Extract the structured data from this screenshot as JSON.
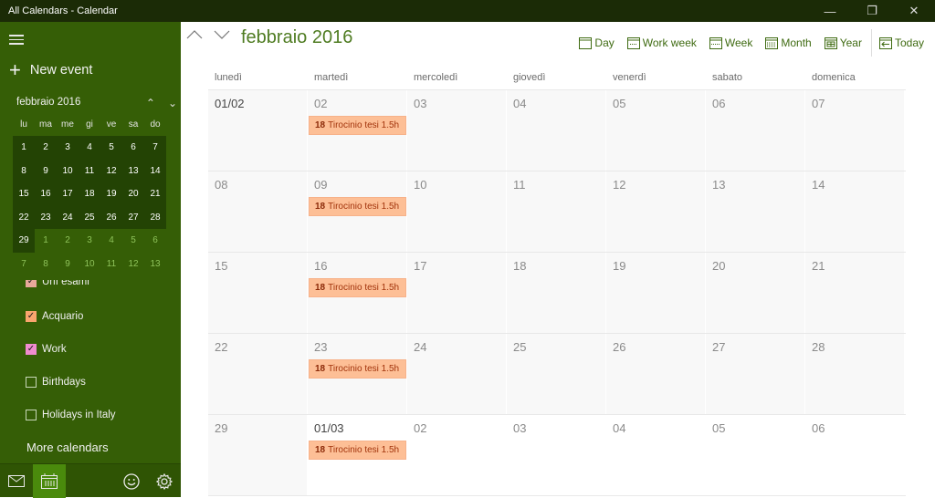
{
  "window": {
    "title": "All Calendars - Calendar",
    "controls": [
      "minimize",
      "restore",
      "close"
    ]
  },
  "sidebar": {
    "new_event_label": "New event",
    "mini_calendar": {
      "month_label": "febbraio 2016",
      "weekdays": [
        "lu",
        "ma",
        "me",
        "gi",
        "ve",
        "sa",
        "do"
      ],
      "days": [
        {
          "d": "1",
          "cur": true
        },
        {
          "d": "2",
          "cur": true
        },
        {
          "d": "3",
          "cur": true
        },
        {
          "d": "4",
          "cur": true
        },
        {
          "d": "5",
          "cur": true
        },
        {
          "d": "6",
          "cur": true
        },
        {
          "d": "7",
          "cur": true
        },
        {
          "d": "8",
          "cur": true
        },
        {
          "d": "9",
          "cur": true
        },
        {
          "d": "10",
          "cur": true
        },
        {
          "d": "11",
          "cur": true
        },
        {
          "d": "12",
          "cur": true
        },
        {
          "d": "13",
          "cur": true
        },
        {
          "d": "14",
          "cur": true
        },
        {
          "d": "15",
          "cur": true
        },
        {
          "d": "16",
          "cur": true
        },
        {
          "d": "17",
          "cur": true
        },
        {
          "d": "18",
          "cur": true
        },
        {
          "d": "19",
          "cur": true
        },
        {
          "d": "20",
          "cur": true
        },
        {
          "d": "21",
          "cur": true
        },
        {
          "d": "22",
          "cur": true
        },
        {
          "d": "23",
          "cur": true
        },
        {
          "d": "24",
          "cur": true
        },
        {
          "d": "25",
          "cur": true
        },
        {
          "d": "26",
          "cur": true
        },
        {
          "d": "27",
          "cur": true
        },
        {
          "d": "28",
          "cur": true
        },
        {
          "d": "29",
          "cur": true
        },
        {
          "d": "1",
          "cur": false
        },
        {
          "d": "2",
          "cur": false
        },
        {
          "d": "3",
          "cur": false
        },
        {
          "d": "4",
          "cur": false
        },
        {
          "d": "5",
          "cur": false
        },
        {
          "d": "6",
          "cur": false
        },
        {
          "d": "7",
          "cur": false
        },
        {
          "d": "8",
          "cur": false
        },
        {
          "d": "9",
          "cur": false
        },
        {
          "d": "10",
          "cur": false
        },
        {
          "d": "11",
          "cur": false
        },
        {
          "d": "12",
          "cur": false
        },
        {
          "d": "13",
          "cur": false
        }
      ]
    },
    "calendars": [
      {
        "label": "Unì esami",
        "checked": true,
        "color": "#e8a89a",
        "partial": true
      },
      {
        "label": "Acquario",
        "checked": true,
        "color": "#f9a56e"
      },
      {
        "label": "Work",
        "checked": true,
        "color": "#f08ccf"
      },
      {
        "label": "Birthdays",
        "checked": false,
        "color": ""
      },
      {
        "label": "Holidays in Italy",
        "checked": false,
        "color": ""
      }
    ],
    "more_calendars_label": "More calendars",
    "bottom_icons": [
      "mail-icon",
      "calendar-icon",
      "feedback-smiley-icon",
      "settings-gear-icon"
    ]
  },
  "main": {
    "month_title": "febbraio 2016",
    "views": [
      {
        "label": "Day",
        "icon": "day-view-icon"
      },
      {
        "label": "Work week",
        "icon": "work-week-view-icon"
      },
      {
        "label": "Week",
        "icon": "week-view-icon"
      },
      {
        "label": "Month",
        "icon": "month-view-icon"
      },
      {
        "label": "Year",
        "icon": "year-view-icon"
      }
    ],
    "today_label": "Today",
    "weekdays": [
      "lunedì",
      "martedì",
      "mercoledì",
      "giovedì",
      "venerdì",
      "sabato",
      "domenica"
    ],
    "weeks": [
      [
        {
          "n": "01/02",
          "first": true
        },
        {
          "n": "02",
          "event": true
        },
        {
          "n": "03"
        },
        {
          "n": "04"
        },
        {
          "n": "05"
        },
        {
          "n": "06"
        },
        {
          "n": "07"
        }
      ],
      [
        {
          "n": "08"
        },
        {
          "n": "09",
          "event": true
        },
        {
          "n": "10"
        },
        {
          "n": "11"
        },
        {
          "n": "12"
        },
        {
          "n": "13"
        },
        {
          "n": "14"
        }
      ],
      [
        {
          "n": "15"
        },
        {
          "n": "16",
          "event": true
        },
        {
          "n": "17"
        },
        {
          "n": "18"
        },
        {
          "n": "19"
        },
        {
          "n": "20"
        },
        {
          "n": "21"
        }
      ],
      [
        {
          "n": "22"
        },
        {
          "n": "23",
          "event": true
        },
        {
          "n": "24"
        },
        {
          "n": "25"
        },
        {
          "n": "26"
        },
        {
          "n": "27"
        },
        {
          "n": "28"
        }
      ],
      [
        {
          "n": "29"
        },
        {
          "n": "01/03",
          "first": true,
          "next": true,
          "event": true
        },
        {
          "n": "02",
          "next": true
        },
        {
          "n": "03",
          "next": true
        },
        {
          "n": "04",
          "next": true
        },
        {
          "n": "05",
          "next": true
        },
        {
          "n": "06",
          "next": true
        }
      ]
    ],
    "event": {
      "time": "18",
      "title": "Tirocinio tesi 1.5h",
      "color": "#fdbf96"
    }
  },
  "colors": {
    "sidebar": "#355e06",
    "titlebar": "#1b2b06",
    "accent": "#4f7c22",
    "event_bg": "#fdbf96",
    "event_text": "#a2340c"
  }
}
